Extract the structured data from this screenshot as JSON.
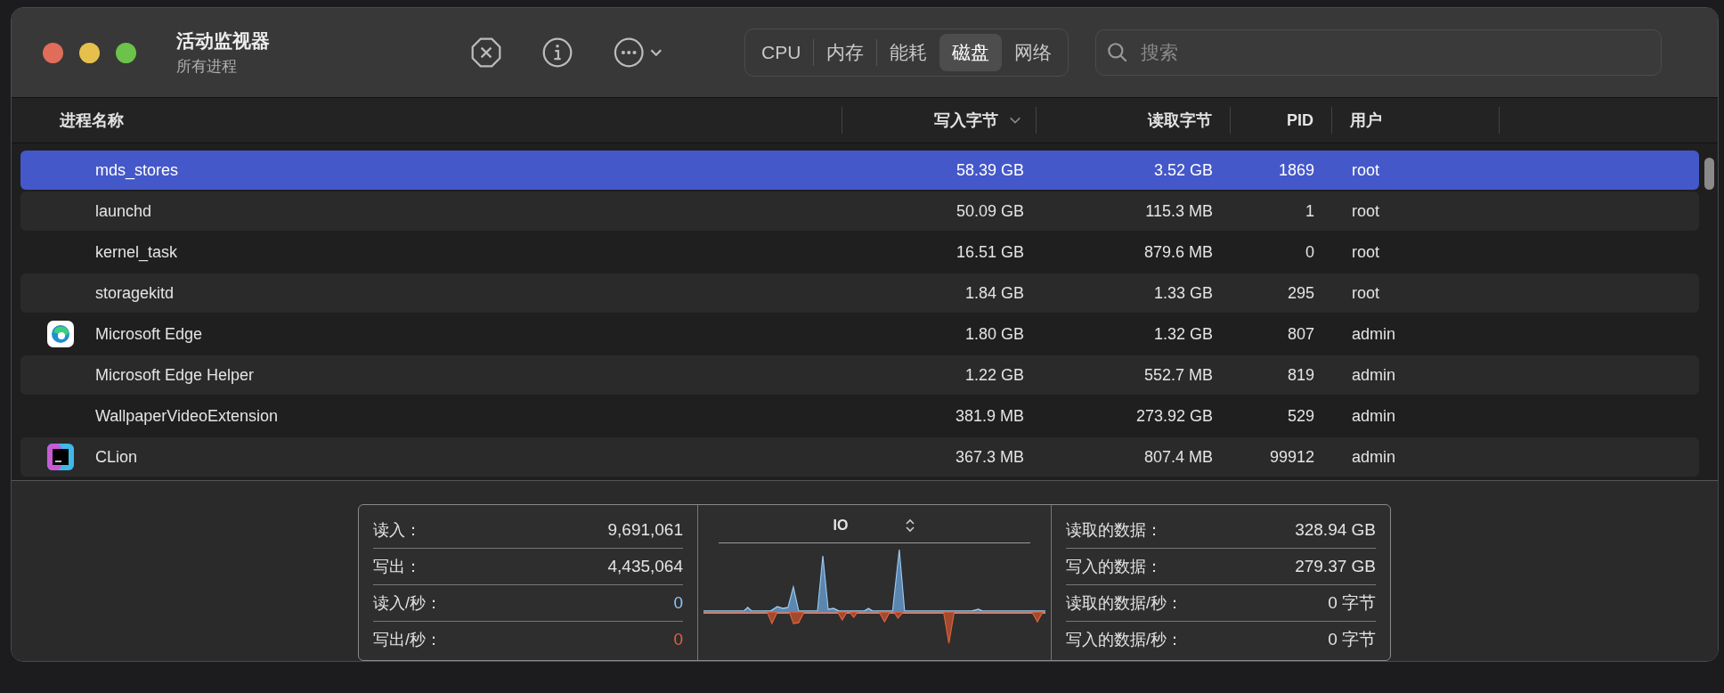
{
  "window": {
    "title": "活动监视器",
    "subtitle": "所有进程"
  },
  "tabs": [
    {
      "label": "CPU",
      "selected": false
    },
    {
      "label": "内存",
      "selected": false
    },
    {
      "label": "能耗",
      "selected": false
    },
    {
      "label": "磁盘",
      "selected": true
    },
    {
      "label": "网络",
      "selected": false
    }
  ],
  "search": {
    "placeholder": "搜索"
  },
  "table": {
    "columns": [
      {
        "label": "进程名称",
        "sorted": false
      },
      {
        "label": "写入字节",
        "sorted": true
      },
      {
        "label": "读取字节",
        "sorted": false
      },
      {
        "label": "PID",
        "sorted": false
      },
      {
        "label": "用户",
        "sorted": false
      }
    ],
    "rows": [
      {
        "name": "mds_stores",
        "write": "58.39 GB",
        "read": "3.52 GB",
        "pid": "1869",
        "user": "root",
        "selected": true
      },
      {
        "name": "launchd",
        "write": "50.09 GB",
        "read": "115.3 MB",
        "pid": "1",
        "user": "root",
        "selected": false
      },
      {
        "name": "kernel_task",
        "write": "16.51 GB",
        "read": "879.6 MB",
        "pid": "0",
        "user": "root",
        "selected": false
      },
      {
        "name": "storagekitd",
        "write": "1.84 GB",
        "read": "1.33 GB",
        "pid": "295",
        "user": "root",
        "selected": false
      },
      {
        "name": "Microsoft Edge",
        "kind": "edge",
        "write": "1.80 GB",
        "read": "1.32 GB",
        "pid": "807",
        "user": "admin",
        "selected": false
      },
      {
        "name": "Microsoft Edge Helper",
        "write": "1.22 GB",
        "read": "552.7 MB",
        "pid": "819",
        "user": "admin",
        "selected": false
      },
      {
        "name": "WallpaperVideoExtension",
        "write": "381.9 MB",
        "read": "273.92 GB",
        "pid": "529",
        "user": "admin",
        "selected": false
      },
      {
        "name": "CLion",
        "kind": "clion",
        "write": "367.3 MB",
        "read": "807.4 MB",
        "pid": "99912",
        "user": "admin",
        "selected": false
      }
    ]
  },
  "stats": {
    "left": [
      {
        "label": "读入：",
        "value": "9,691,061"
      },
      {
        "label": "写出：",
        "value": "4,435,064"
      },
      {
        "label": "读入/秒：",
        "value": "0",
        "color": "#8cc4f2"
      },
      {
        "label": "写出/秒：",
        "value": "0",
        "color": "#e0603c"
      }
    ],
    "chart": {
      "title": "IO"
    },
    "right": [
      {
        "label": "读取的数据：",
        "value": "328.94 GB"
      },
      {
        "label": "写入的数据：",
        "value": "279.37 GB"
      },
      {
        "label": "读取的数据/秒：",
        "value": "0 字节"
      },
      {
        "label": "写入的数据/秒：",
        "value": "0 字节"
      }
    ]
  }
}
